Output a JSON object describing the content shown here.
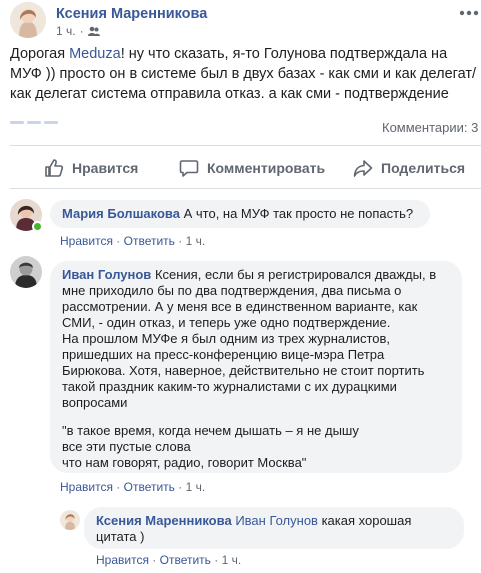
{
  "post": {
    "author": "Ксения Маренникова",
    "time": "1 ч.",
    "text_line1_prefix": "Дорогая ",
    "text_line1_mention": "Meduza",
    "text_line1_suffix": "! ну что сказать, я-то Голунова подтверждала на",
    "text_line2": "МУФ )) просто он в системе был в двух базах - как сми и как делегат/",
    "text_line3": "как делегат система отправила отказ. а как сми - подтверждение",
    "comments_count": "Комментарии: 3",
    "actions": {
      "like": "Нравится",
      "comment": "Комментировать",
      "share": "Поделиться"
    }
  },
  "comments": [
    {
      "author": "Мария Болшакова",
      "text": "А что, на МУФ так просто не попасть?",
      "like": "Нравится",
      "reply": "Ответить",
      "time": "1 ч."
    },
    {
      "author": "Иван Голунов",
      "lines": [
        "Ксения, если бы я регистрировался дважды, в",
        "мне приходило бы по два подтверждения, два письма о",
        "рассмотрении. А у меня все в единственном варианте, как",
        "СМИ, - один отказ, и теперь уже одно подтверждение.",
        "На прошлом МУФе я был одним из трех журналистов,",
        "пришедших на пресс-конференцию вице-мэра Петра",
        "Бирюкова. Хотя, наверное, действительно не стоит портить",
        "такой праздник каким-то журналистами с их дурацкими",
        "вопросами"
      ],
      "quote": [
        "\"в такое время, когда нечем дышать – я не дышу",
        "все эти пустые слова",
        "что нам говорят, радио, говорит Москва\""
      ],
      "like": "Нравится",
      "reply": "Ответить",
      "time": "1 ч."
    },
    {
      "author": "Ксения Маренникова",
      "mention": "Иван Голунов",
      "text_line1": "какая хорошая",
      "text_line2": "цитата )",
      "like": "Нравится",
      "reply": "Ответить",
      "time": "1 ч."
    }
  ],
  "separator": "·",
  "colors": {
    "link": "#385898",
    "bubble": "#f2f3f5",
    "muted": "#606770",
    "online": "#42b72a"
  },
  "icons": {
    "more": "ellipsis-icon",
    "like": "thumbs-up-icon",
    "comment": "speech-bubble-icon",
    "share": "share-arrow-icon"
  }
}
